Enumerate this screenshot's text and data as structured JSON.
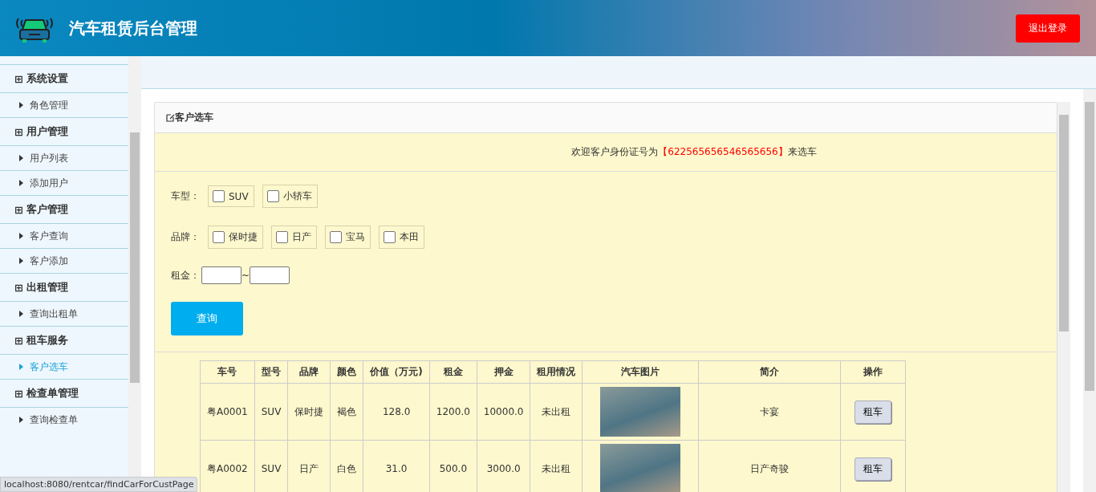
{
  "header": {
    "title": "汽车租赁后台管理",
    "logout": "退出登录"
  },
  "sidebar": {
    "groups": [
      {
        "label": "系统设置",
        "icon": "⊞",
        "children": [
          {
            "label": "角色管理",
            "selected": false
          }
        ]
      },
      {
        "label": "用户管理",
        "icon": "⊞",
        "children": [
          {
            "label": "用户列表",
            "selected": false
          },
          {
            "label": "添加用户",
            "selected": false
          }
        ]
      },
      {
        "label": "客户管理",
        "icon": "⊞",
        "children": [
          {
            "label": "客户查询",
            "selected": false
          },
          {
            "label": "客户添加",
            "selected": false
          }
        ]
      },
      {
        "label": "出租管理",
        "icon": "⊞",
        "children": [
          {
            "label": "查询出租单",
            "selected": false
          }
        ]
      },
      {
        "label": "租车服务",
        "icon": "⊞",
        "children": [
          {
            "label": "客户选车",
            "selected": true
          }
        ]
      },
      {
        "label": "检查单管理",
        "icon": "⊞",
        "children": [
          {
            "label": "查询检查单",
            "selected": false
          }
        ]
      }
    ]
  },
  "panel": {
    "title": "客户选车",
    "welcome": "欢迎客户身份证号为**【622565656546565656】**来选车",
    "filters": [
      {
        "kind": "checks",
        "label": "车型：",
        "options": [
          {
            "label": "SUV",
            "checked": false
          },
          {
            "label": "小轿车",
            "checked": false
          }
        ]
      },
      {
        "kind": "checks",
        "label": "品牌：",
        "options": [
          {
            "label": "保时捷",
            "checked": false
          },
          {
            "label": "日产",
            "checked": false
          },
          {
            "label": "宝马",
            "checked": false
          },
          {
            "label": "本田",
            "checked": false
          }
        ]
      },
      {
        "kind": "range",
        "label": "租金：",
        "separator": "~"
      }
    ],
    "search_button": "查询"
  },
  "table": {
    "columns": [
      "车号",
      "型号",
      "品牌",
      "颜色",
      "价值（万元)",
      "租金",
      "押金",
      "租用情况",
      "汽车图片",
      "简介",
      "操作"
    ],
    "rows": [
      {
        "cells": [
          "粤A0001",
          "SUV",
          "保时捷",
          "褐色",
          "128.0",
          "1200.0",
          "10000.0",
          "未出租"
        ],
        "intro": "卡宴",
        "action": "租车"
      },
      {
        "cells": [
          "粤A0002",
          "SUV",
          "日产",
          "白色",
          "31.0",
          "500.0",
          "3000.0",
          "未出租"
        ],
        "intro": "日产奇骏",
        "action": "租车"
      }
    ]
  },
  "status_bar": "localhost:8080/rentcar/findCarForCustPage"
}
